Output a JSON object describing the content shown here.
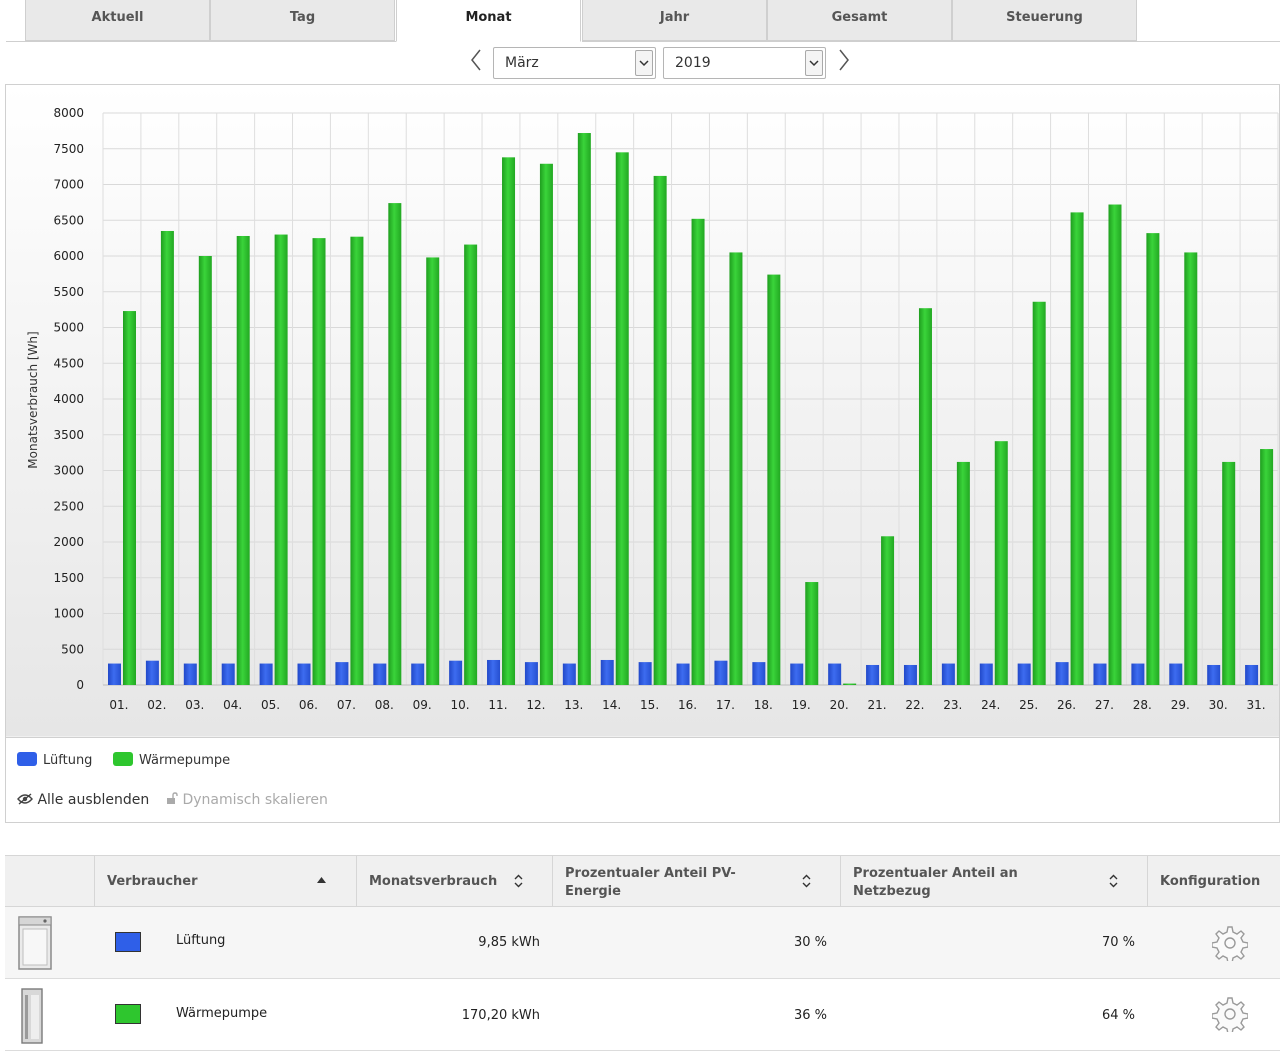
{
  "tabs": [
    {
      "label": "Aktuell",
      "active": false
    },
    {
      "label": "Tag",
      "active": false
    },
    {
      "label": "Monat",
      "active": true
    },
    {
      "label": "Jahr",
      "active": false
    },
    {
      "label": "Gesamt",
      "active": false
    },
    {
      "label": "Steuerung",
      "active": false
    }
  ],
  "period": {
    "month": "März",
    "year": "2019"
  },
  "chart_data": {
    "type": "bar",
    "ylabel": "Monatsverbrauch [Wh]",
    "ylim": [
      0,
      8000
    ],
    "yticks": [
      0,
      500,
      1000,
      1500,
      2000,
      2500,
      3000,
      3500,
      4000,
      4500,
      5000,
      5500,
      6000,
      6500,
      7000,
      7500,
      8000
    ],
    "grid": true,
    "legend_position": "bottom-left",
    "categories": [
      "01.",
      "02.",
      "03.",
      "04.",
      "05.",
      "06.",
      "07.",
      "08.",
      "09.",
      "10.",
      "11.",
      "12.",
      "13.",
      "14.",
      "15.",
      "16.",
      "17.",
      "18.",
      "19.",
      "20.",
      "21.",
      "22.",
      "23.",
      "24.",
      "25.",
      "26.",
      "27.",
      "28.",
      "29.",
      "30.",
      "31."
    ],
    "series": [
      {
        "name": "Lüftung",
        "color": "#2f5fe8",
        "values": [
          300,
          340,
          300,
          300,
          300,
          300,
          320,
          300,
          300,
          340,
          350,
          320,
          300,
          350,
          320,
          300,
          340,
          320,
          300,
          300,
          280,
          280,
          300,
          300,
          300,
          320,
          300,
          300,
          300,
          280,
          280
        ]
      },
      {
        "name": "Wärmepumpe",
        "color": "#2ec62e",
        "values": [
          5230,
          6350,
          6000,
          6280,
          6300,
          6250,
          6270,
          6740,
          5980,
          6160,
          7380,
          7290,
          7720,
          7450,
          7120,
          6520,
          6050,
          5740,
          1440,
          20,
          2080,
          5270,
          3120,
          3410,
          5360,
          6610,
          6720,
          6320,
          6050,
          3120,
          3300
        ]
      }
    ]
  },
  "legend": [
    {
      "label": "Lüftung",
      "color": "#2f5fe8"
    },
    {
      "label": "Wärmepumpe",
      "color": "#2ec62e"
    }
  ],
  "tools": {
    "hide_all": "Alle ausblenden",
    "dynamic_scale": "Dynamisch skalieren"
  },
  "table": {
    "headers": {
      "consumer": "Verbraucher",
      "monthly": "Monatsverbrauch",
      "pv_share_1": "Prozentualer Anteil PV-",
      "pv_share_2": "Energie",
      "grid_share_1": "Prozentualer Anteil an",
      "grid_share_2": "Netzbezug",
      "config": "Konfiguration"
    },
    "rows": [
      {
        "name": "Lüftung",
        "color": "#2f5fe8",
        "consumption": "9,85 kWh",
        "pv_share": "30 %",
        "grid_share": "70 %",
        "device_icon": "ventilation-unit-icon"
      },
      {
        "name": "Wärmepumpe",
        "color": "#2ec62e",
        "consumption": "170,20 kWh",
        "pv_share": "36 %",
        "grid_share": "64 %",
        "device_icon": "heat-pump-icon"
      }
    ]
  }
}
